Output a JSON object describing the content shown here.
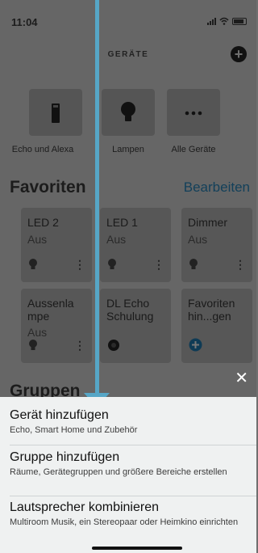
{
  "status_bar": {
    "time": "11:04"
  },
  "header": {
    "title": "GERÄTE",
    "add_symbol": "+"
  },
  "categories": [
    {
      "label": "Echo und Alexa",
      "icon": "echo-speaker-icon"
    },
    {
      "label": "Lampen",
      "icon": "lightbulb-icon"
    },
    {
      "label": "Alle Geräte",
      "icon": "more-dots-icon"
    }
  ],
  "favorites": {
    "title": "Favoriten",
    "edit_label": "Bearbeiten",
    "cards": [
      {
        "name": "LED 2",
        "state": "Aus",
        "icon": "lightbulb-icon"
      },
      {
        "name": "LED 1",
        "state": "Aus",
        "icon": "lightbulb-icon"
      },
      {
        "name": "Dimmer",
        "state": "Aus",
        "icon": "lightbulb-icon"
      },
      {
        "name": "Aussenla\nmpe",
        "state": "Aus",
        "icon": "lightbulb-icon"
      },
      {
        "name": "DL Echo\nSchulung",
        "state": "",
        "icon": "echo-dot-icon"
      },
      {
        "name": "Favoriten\nhin...gen",
        "state": "",
        "icon": "add-circle-icon"
      }
    ]
  },
  "groups": {
    "title": "Gruppen"
  },
  "sheet": {
    "close_symbol": "✕",
    "options": [
      {
        "title": "Gerät hinzufügen",
        "subtitle": "Echo, Smart Home und Zubehör"
      },
      {
        "title": "Gruppe hinzufügen",
        "subtitle": "Räume, Gerätegruppen und größere Bereiche erstellen"
      },
      {
        "title": "Lautsprecher kombinieren",
        "subtitle": "Multiroom Musik, ein Stereopaar oder Heimkino einrichten"
      }
    ]
  },
  "colors": {
    "annotation_arrow": "#56a6c6",
    "accent_link": "#13405a",
    "sheet_bg": "#eff1f1"
  }
}
